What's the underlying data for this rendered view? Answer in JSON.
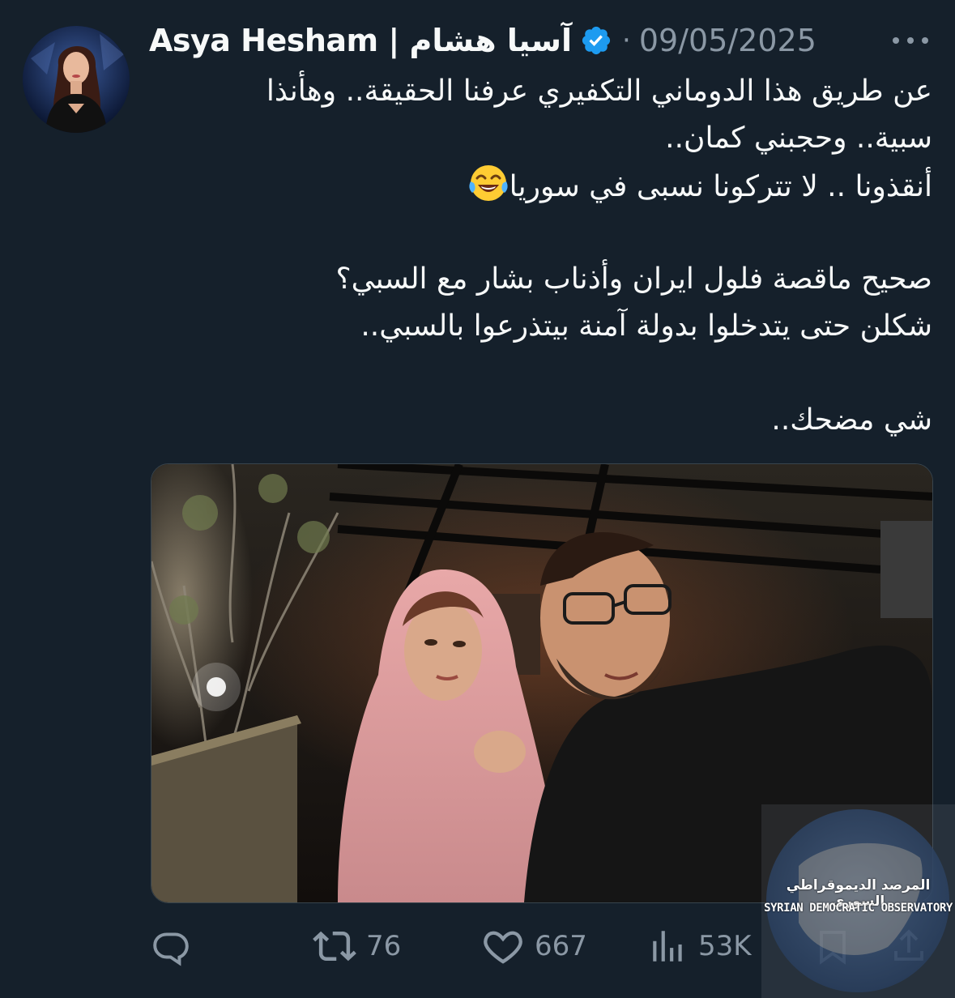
{
  "tweet": {
    "author": {
      "display_name": "Asya Hesham | آسيا هشام",
      "verified": true,
      "avatar_icon": "profile-photo"
    },
    "date": "09/05/2025",
    "separator": "·",
    "more_icon": "ellipsis-icon",
    "text_lines": [
      "عن طريق هذا الدوماني التكفيري عرفنا الحقيقة.. وهأنذا",
      "سبية.. وحجبني كمان..",
      "أنقذونا .. لا تتركونا نسبى في سوريا",
      "",
      "صحيح ماقصة فلول ايران وأذناب بشار مع السبي؟",
      "شكلن حتى يتدخلوا بدولة آمنة بيتذرعوا بالسبي..",
      "",
      "شي مضحك.."
    ],
    "emoji": "face-with-tears-of-joy",
    "media": {
      "description_icon": "photo"
    },
    "actions": {
      "reply": {
        "icon": "reply-icon",
        "count": ""
      },
      "retweet": {
        "icon": "retweet-icon",
        "count": "76"
      },
      "like": {
        "icon": "heart-icon",
        "count": "667"
      },
      "views": {
        "icon": "analytics-icon",
        "count": "53K"
      },
      "bookmark": {
        "icon": "bookmark-icon"
      },
      "share": {
        "icon": "share-icon"
      }
    }
  },
  "watermark": {
    "arabic": "المرصد الديموقراطي السوري",
    "english": "SYRIAN DEMOCRATIC OBSERVATORY"
  },
  "colors": {
    "background": "#15202b",
    "text": "#f7f9f9",
    "secondary": "#8b98a5",
    "verified": "#1d9bf0",
    "border": "#38444d"
  }
}
